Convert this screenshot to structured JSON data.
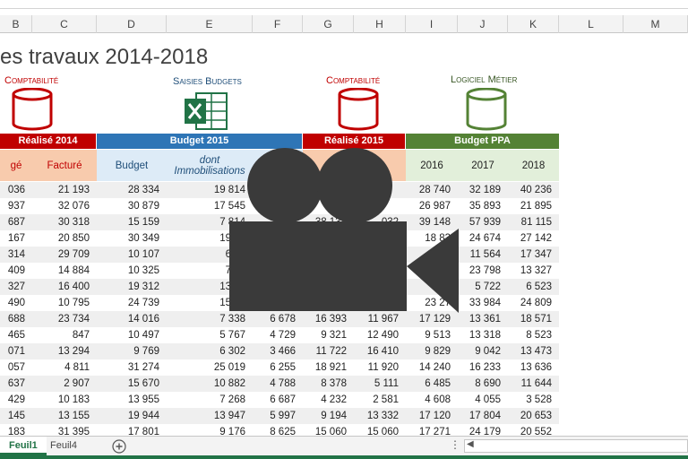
{
  "sheet": {
    "columns": [
      "B",
      "C",
      "D",
      "E",
      "F",
      "G",
      "H",
      "I",
      "J",
      "K",
      "L",
      "M"
    ],
    "title": "es travaux 2014-2018",
    "sources": [
      {
        "label": "Comptabilité",
        "color": "#c00000"
      },
      {
        "label": "Saisies Budgets",
        "color": "#1f4e79"
      },
      {
        "label": "Comptabilité",
        "color": "#c00000"
      },
      {
        "label": "Logiciel Métier",
        "color": "#375623"
      }
    ],
    "groups": [
      {
        "label": "Réalisé 2014",
        "color": "#c00000"
      },
      {
        "label": "Budget 2015",
        "color": "#2e75b6"
      },
      {
        "label": "Réalisé 2015",
        "color": "#c00000"
      },
      {
        "label": "Budget PPA",
        "color": "#548235"
      }
    ],
    "subheaders": [
      "gé",
      "Facturé",
      "Budget",
      "dont Immobilisations",
      "",
      "",
      "é",
      "2016",
      "2017",
      "2018"
    ],
    "rows": [
      [
        "036",
        "21 193",
        "28 334",
        "19 814",
        "",
        "",
        "",
        "28 740",
        "32 189",
        "40 236"
      ],
      [
        "937",
        "32 076",
        "30 879",
        "17 545",
        "",
        "",
        "",
        "26 987",
        "35 893",
        "21 895"
      ],
      [
        "687",
        "30 318",
        "15 159",
        "7 814",
        "",
        "38 134",
        "032",
        "39 148",
        "57 939",
        "81 115"
      ],
      [
        "167",
        "20 850",
        "30 349",
        "19 96",
        "",
        "",
        "",
        "18 83",
        "24 674",
        "27 142"
      ],
      [
        "314",
        "29 709",
        "10 107",
        "6 16",
        "",
        "",
        "",
        "",
        "11 564",
        "17 347"
      ],
      [
        "409",
        "14 884",
        "10 325",
        "7 17",
        "",
        "",
        "",
        "",
        "23 798",
        "13 327"
      ],
      [
        "327",
        "16 400",
        "19 312",
        "13 60",
        "",
        "",
        "",
        "",
        "5 722",
        "6 523"
      ],
      [
        "490",
        "10 795",
        "24 739",
        "15 96",
        "",
        "",
        "",
        "23 27",
        "33 984",
        "24 809"
      ],
      [
        "688",
        "23 734",
        "14 016",
        "7 338",
        "6 678",
        "16 393",
        "11 967",
        "17 129",
        "13 361",
        "18 571"
      ],
      [
        "465",
        "847",
        "10 497",
        "5 767",
        "4 729",
        "9 321",
        "12 490",
        "9 513",
        "13 318",
        "8 523"
      ],
      [
        "071",
        "13 294",
        "9 769",
        "6 302",
        "3 466",
        "11 722",
        "16 410",
        "9 829",
        "9 042",
        "13 473"
      ],
      [
        "057",
        "4 811",
        "31 274",
        "25 019",
        "6 255",
        "18 921",
        "11 920",
        "14 240",
        "16 233",
        "13 636"
      ],
      [
        "637",
        "2 907",
        "15 670",
        "10 882",
        "4 788",
        "8 378",
        "5 111",
        "6 485",
        "8 690",
        "11 644"
      ],
      [
        "429",
        "10 183",
        "13 955",
        "7 268",
        "6 687",
        "4 232",
        "2 581",
        "4 608",
        "4 055",
        "3 528"
      ],
      [
        "145",
        "13 155",
        "19 944",
        "13 947",
        "5 997",
        "9 194",
        "13 332",
        "17 120",
        "17 804",
        "20 653"
      ],
      [
        "183",
        "31 395",
        "17 801",
        "9 176",
        "8 625",
        "15 060",
        "15 060",
        "17 271",
        "24 179",
        "20 552"
      ]
    ]
  },
  "tabs": [
    {
      "label": "Feuil1",
      "active": true
    },
    {
      "label": "Feuil4",
      "active": false
    }
  ],
  "add_sheet_icon": "plus-circle-icon",
  "camera_overlay_icon": "video-camera-icon"
}
